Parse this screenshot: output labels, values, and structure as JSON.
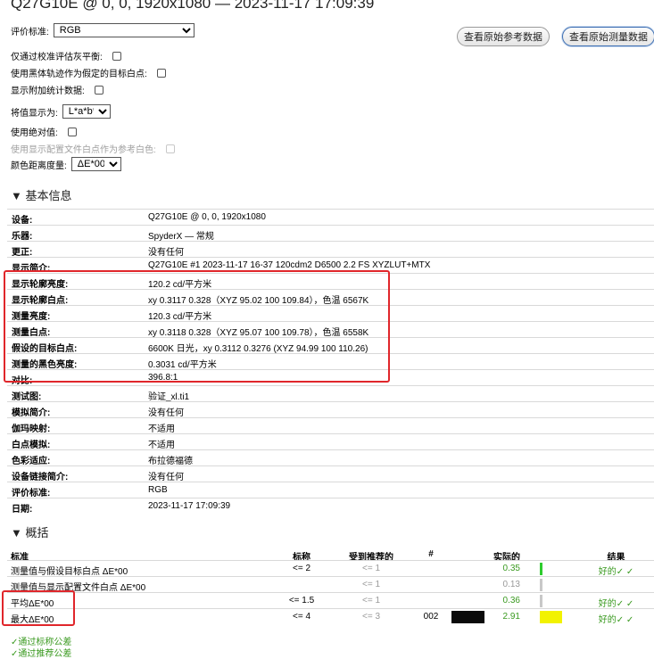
{
  "title": "Q27G10E @ 0, 0, 1920x1080 — 2023-11-17 17:09:39",
  "options": {
    "eval_standard_label": "评价标准:",
    "eval_standard_value": "RGB",
    "grayscale_label": "仅通过校准评估灰平衡:",
    "blackbody_label": "使用黑体轨迹作为假定的目标白点:",
    "extra_stats_label": "显示附加统计数据:",
    "display_values_label": "将值显示为:",
    "display_values_value": "L*a*b*",
    "absolute_label": "使用绝对值:",
    "profile_white_label": "使用显示配置文件白点作为参考白色:",
    "delta_label": "颜色距离度量:",
    "delta_value": "ΔE*00"
  },
  "buttons": {
    "view_reference": "查看原始参考数据",
    "view_measurement": "查看原始测量数据"
  },
  "basic_info": {
    "heading": "▼ 基本信息",
    "rows": [
      {
        "key": "设备:",
        "value": "Q27G10E @ 0, 0, 1920x1080"
      },
      {
        "key": "乐器:",
        "value": "SpyderX — 常规"
      },
      {
        "key": "更正:",
        "value": "没有任何"
      },
      {
        "key": "显示简介:",
        "value": "Q27G10E #1 2023-11-17 16-37 120cdm2 D6500 2.2 FS XYZLUT+MTX"
      },
      {
        "key": "显示轮廓亮度:",
        "value": "120.2 cd/平方米"
      },
      {
        "key": "显示轮廓白点:",
        "value": "xy 0.3117 0.328（XYZ 95.02 100 109.84），色温 6567K"
      },
      {
        "key": "测量亮度:",
        "value": "120.3 cd/平方米"
      },
      {
        "key": "测量白点:",
        "value": "xy 0.3118 0.328（XYZ 95.07 100 109.78），色温 6558K"
      },
      {
        "key": "假设的目标白点:",
        "value": "6600K 日光，xy 0.3112 0.3276 (XYZ 94.99 100 110.26)"
      },
      {
        "key": "测量的黑色亮度:",
        "value": "0.3031 cd/平方米"
      },
      {
        "key": "对比:",
        "value": "396.8:1"
      },
      {
        "key": "测试图:",
        "value": "验证_xl.ti1"
      },
      {
        "key": "模拟简介:",
        "value": "没有任何"
      },
      {
        "key": "伽玛映射:",
        "value": "不适用"
      },
      {
        "key": "白点模拟:",
        "value": "不适用"
      },
      {
        "key": "色彩适应:",
        "value": "布拉德福德"
      },
      {
        "key": "设备链接简介:",
        "value": "没有任何"
      },
      {
        "key": "评价标准:",
        "value": "RGB"
      },
      {
        "key": "日期:",
        "value": "2023-11-17 17:09:39"
      }
    ]
  },
  "summary": {
    "heading": "▼ 概括",
    "headers": {
      "criteria": "标准",
      "nominal": "标称",
      "recommended": "受到推荐的",
      "hash": "#",
      "actual": "实际的",
      "result": "结果"
    },
    "rows": [
      {
        "label": "测量值与假设目标白点 ΔE*00",
        "nominal": "<= 2",
        "recommended": "<= 1",
        "hash": "",
        "actual": "0.35",
        "bar_color": "#2ecc2e",
        "bar_fraction": 0.06,
        "result": "好的✓ ✓"
      },
      {
        "label": "测量值与显示配置文件白点 ΔE*00",
        "nominal": "",
        "recommended": "<= 1",
        "hash": "",
        "actual": "0.13",
        "bar_color": "#c8c8c8",
        "bar_fraction": 0.03,
        "result": ""
      },
      {
        "label": "平均ΔE*00",
        "nominal": "<= 1.5",
        "recommended": "<= 1",
        "hash": "",
        "actual": "0.36",
        "bar_color": "#c8c8c8",
        "bar_fraction": 0.03,
        "result": "好的✓ ✓"
      },
      {
        "label": "最大ΔE*00",
        "nominal": "<= 4",
        "recommended": "<= 3",
        "hash": "002",
        "actual": "2.91",
        "bar_color": "#f2f200",
        "bar_fraction": 1.0,
        "result": "好的✓ ✓"
      }
    ]
  },
  "footer": {
    "pass_nominal": "✓通过标称公差",
    "pass_recommended": "✓通过推荐公差"
  },
  "colors": {
    "highlight_box": "#e0262b",
    "pass_green": "#3a9a20"
  }
}
